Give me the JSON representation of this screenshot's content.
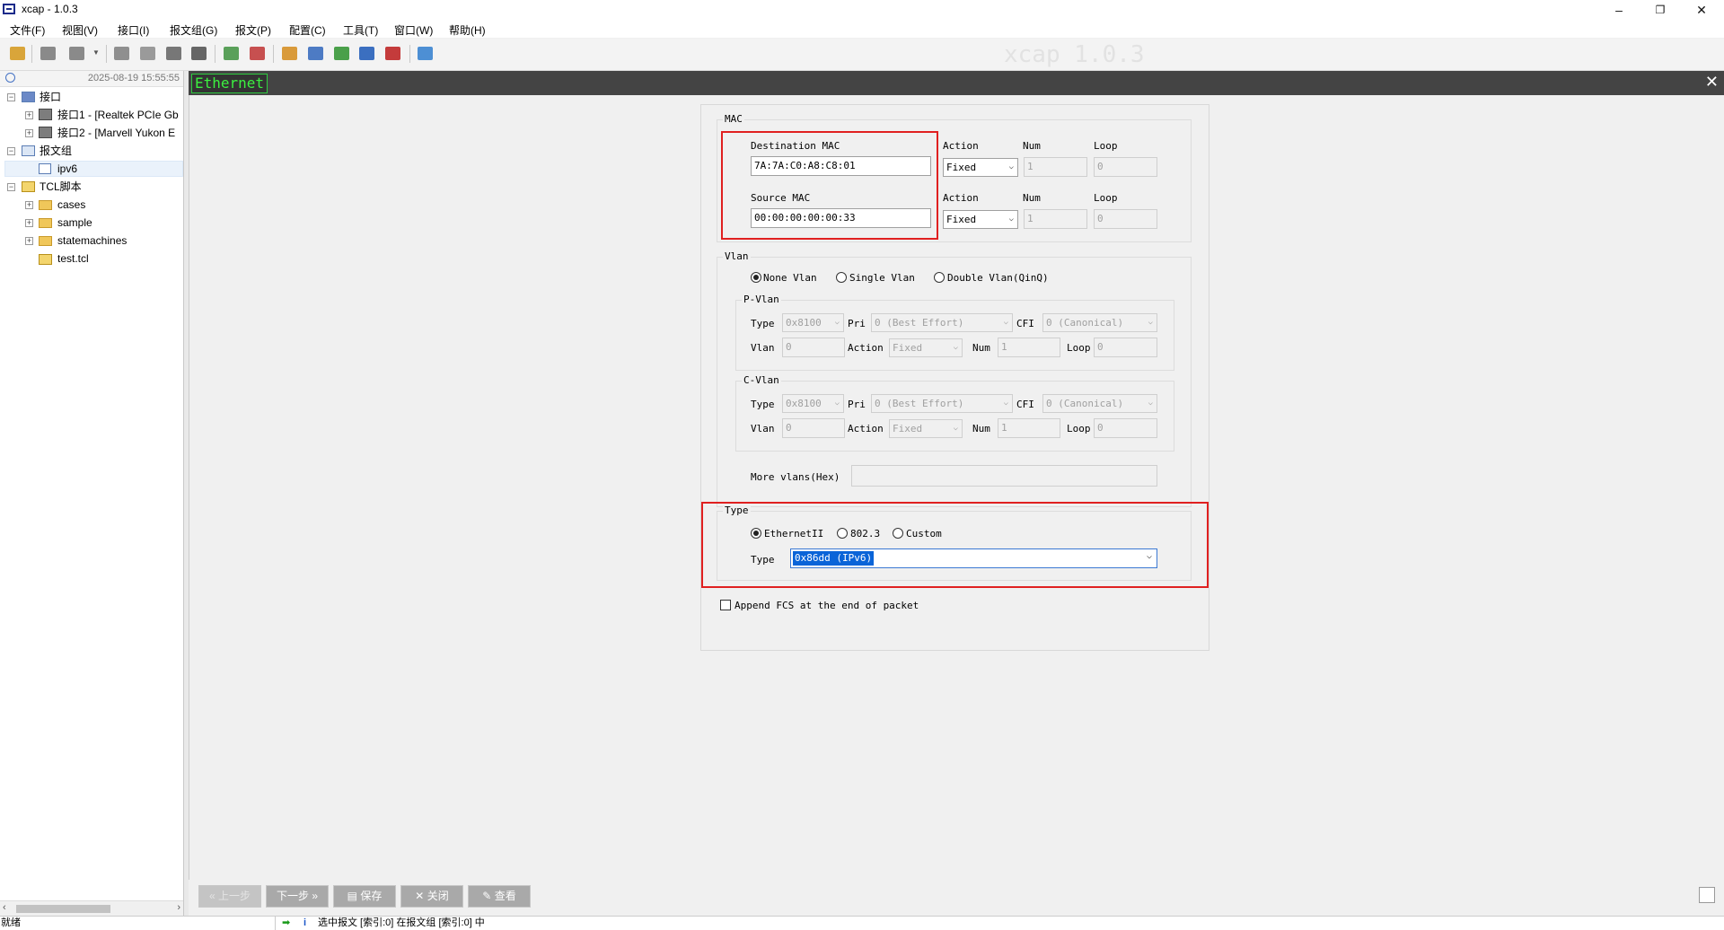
{
  "window": {
    "title": "xcap - 1.0.3",
    "minimize": "–",
    "maximize": "❐",
    "close": "✕"
  },
  "menu": [
    "文件(F)",
    "视图(V)",
    "接口(I)",
    "报文组(G)",
    "报文(P)",
    "配置(C)",
    "工具(T)",
    "窗口(W)",
    "帮助(H)"
  ],
  "watermark": "xcap 1.0.3",
  "left": {
    "datetime": "2025-08-19 15:55:55",
    "tree": {
      "interfaces": "接口",
      "iface1": "接口1 - [Realtek PCIe Gb",
      "iface2": "接口2 - [Marvell Yukon E",
      "groups": "报文组",
      "ipv6": "ipv6",
      "tcl": "TCL脚本",
      "cases": "cases",
      "sample": "sample",
      "statemachines": "statemachines",
      "testtcl": "test.tcl"
    }
  },
  "main": {
    "header_label": "Ethernet",
    "close": "✕",
    "mac": {
      "title": "MAC",
      "dst_label": "Destination MAC",
      "dst_value": "7A:7A:C0:A8:C8:01",
      "src_label": "Source MAC",
      "src_value": "00:00:00:00:00:33",
      "action_label": "Action",
      "num_label": "Num",
      "loop_label": "Loop",
      "action_value": "Fixed",
      "num_value": "1",
      "loop_value": "0"
    },
    "vlan": {
      "title": "Vlan",
      "opt_none": "None Vlan",
      "opt_single": "Single Vlan",
      "opt_double": "Double Vlan(QinQ)",
      "p_title": "P-Vlan",
      "c_title": "C-Vlan",
      "type_label": "Type",
      "type_value": "0x8100",
      "pri_label": "Pri",
      "pri_value": "0 (Best Effort)",
      "cfi_label": "CFI",
      "cfi_value": "0 (Canonical)",
      "vlan_label": "Vlan",
      "vlan_value": "0",
      "action_label": "Action",
      "action_value": "Fixed",
      "num_label": "Num",
      "num_value": "1",
      "loop_label": "Loop",
      "loop_value": "0",
      "more_label": "More vlans(Hex)"
    },
    "type": {
      "title": "Type",
      "opt_eth2": "EthernetII",
      "opt_8023": "802.3",
      "opt_custom": "Custom",
      "type_label": "Type",
      "type_value": "0x86dd (IPv6)"
    },
    "fcs_label": "Append FCS at the end of packet"
  },
  "buttons": {
    "prev": "上一步",
    "next": "下一步",
    "save": "保存",
    "close": "关闭",
    "view": "查看"
  },
  "status": {
    "ready": "就绪",
    "message": "选中报文 [索引:0] 在报文组 [索引:0] 中"
  }
}
